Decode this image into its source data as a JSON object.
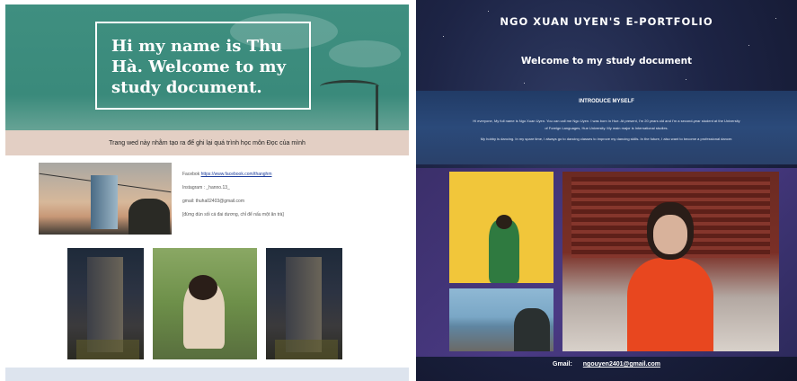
{
  "left_page": {
    "hero_title": "Hi my name is Thu Hà. Welcome to my study document.",
    "banner_text": "Trang wed này nhằm tạo ra để ghi lại quá trình học môn Đọc của mình",
    "contact": {
      "facebook_label": "Facebok",
      "facebook_link": "https://www.facebook.com/thanghm",
      "instagram": "Instagram : _hanno.13_",
      "gmail": "gmail: thuha02403@gmail.com",
      "quote": "[đừng dùn sối cá đai dương, chỉ để nấu một ăn trà]"
    }
  },
  "right_page": {
    "site_title": "NGO XUAN UYEN'S E-PORTFOLIO",
    "welcome": "Welcome to my study document",
    "intro_heading": "INTRODUCE MYSELF",
    "intro_line1": "Hi everyone, My full name is Ngo Xuan Uyen. You can call me Ngo Uyen. I was born in Hue. At present, I'm 20 years old and I'm a second-year student at the University",
    "intro_line2": "of Foreign Languages, Hue University. My main major is International studies.",
    "intro_line3": "My hobby is dancing. In my spare time, I always go to dancing classes to improve my dancing skills. In the future, I also want to become a professional dancer.",
    "contact_label": "Gmail:",
    "contact_email": "ngouyen2401@gmail.com"
  }
}
